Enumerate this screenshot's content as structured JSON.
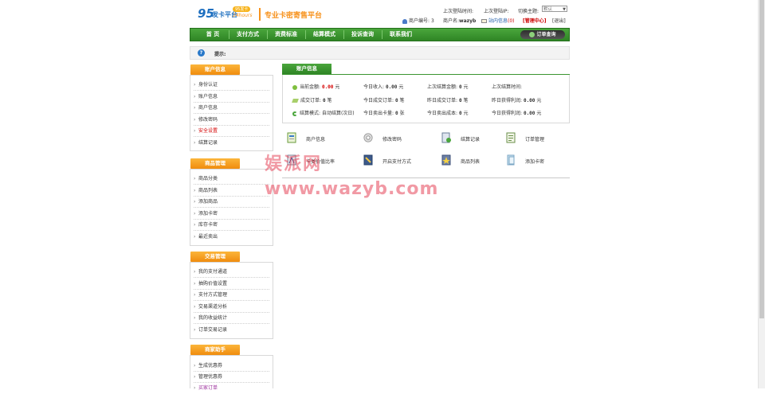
{
  "header": {
    "logo_number": "95",
    "logo_text": "发卡平台",
    "logo_badge": "95发卡",
    "logo_sub": "24hours",
    "slogan": "专业卡密寄售平台",
    "last_login_time_label": "上次登陆时间:",
    "last_login_ip_label": "上次登陆IP:",
    "theme_label": "切换主题:",
    "theme_value": "默认",
    "merchant_id_label": "商户编号:",
    "merchant_id_value": "3",
    "merchant_name_label": "商户名:",
    "merchant_name_value": "wazyb",
    "message_link": "站内信息",
    "message_count": "(0)",
    "admin_link": "[管理中心]",
    "logout_link": "[退出]"
  },
  "nav": {
    "items": [
      "首 页",
      "支付方式",
      "资费标准",
      "结算模式",
      "投诉查询",
      "联系我们"
    ],
    "order_button": "订单查询"
  },
  "tips": {
    "label": "提示:"
  },
  "sidebar": {
    "sections": [
      {
        "title": "账户信息",
        "items": [
          "身份认证",
          "账户信息",
          "商户信息",
          "修改密码",
          "安全设置",
          "结算记录"
        ]
      },
      {
        "title": "商品管理",
        "items": [
          "商品分类",
          "商品列表",
          "添加商品",
          "添加卡密",
          "库存卡密",
          "最近卖出"
        ]
      },
      {
        "title": "交易管理",
        "items": [
          "我的支付通道",
          "抽购价值设置",
          "支付方式管理",
          "交易渠道分析",
          "我的收益统计",
          "订单交易记录"
        ]
      },
      {
        "title": "商家助手",
        "items": [
          "生成优惠券",
          "管理优惠券",
          "买家订单"
        ]
      }
    ]
  },
  "account": {
    "title": "账户信息",
    "rows": [
      [
        {
          "label": "当前金额:",
          "value": "0.00",
          "unit": "元"
        },
        {
          "label": "今日收入:",
          "value": "0.00",
          "unit": "元"
        },
        {
          "label": "上次结算金额:",
          "value": "0",
          "unit": "元"
        },
        {
          "label": "上次结算时间:",
          "value": "",
          "unit": ""
        }
      ],
      [
        {
          "label": "成交订单:",
          "value": "0",
          "unit": "笔"
        },
        {
          "label": "今日成交订单:",
          "value": "0",
          "unit": "笔"
        },
        {
          "label": "昨日成交订单:",
          "value": "0",
          "unit": "笔"
        },
        {
          "label": "昨日获得利润:",
          "value": "0.00",
          "unit": "元"
        }
      ],
      [
        {
          "label": "结算模式:",
          "value": "自动结算(次日)",
          "unit": ""
        },
        {
          "label": "今日卖出卡量:",
          "value": "0",
          "unit": "张"
        },
        {
          "label": "今日卖出成本:",
          "value": "0",
          "unit": "元"
        },
        {
          "label": "今日获得利润:",
          "value": "0.00",
          "unit": "元"
        }
      ]
    ]
  },
  "quick_links": [
    {
      "label": "商户信息",
      "icon": "merchant-info-icon"
    },
    {
      "label": "修改密码",
      "icon": "gear-icon"
    },
    {
      "label": "结算记录",
      "icon": "settlement-icon"
    },
    {
      "label": "订单管理",
      "icon": "order-icon"
    },
    {
      "label": "卡类价值比率",
      "icon": "card-rate-icon"
    },
    {
      "label": "开启支付方式",
      "icon": "payment-icon"
    },
    {
      "label": "商品列表",
      "icon": "product-icon"
    },
    {
      "label": "添加卡密",
      "icon": "add-card-icon"
    }
  ],
  "watermark": {
    "line1": "娱派网",
    "line2": "www.wazyb.com"
  },
  "colors": {
    "nav_green": "#2f8525",
    "sidebar_orange": "#f08c0e",
    "value_red": "#d40000"
  }
}
